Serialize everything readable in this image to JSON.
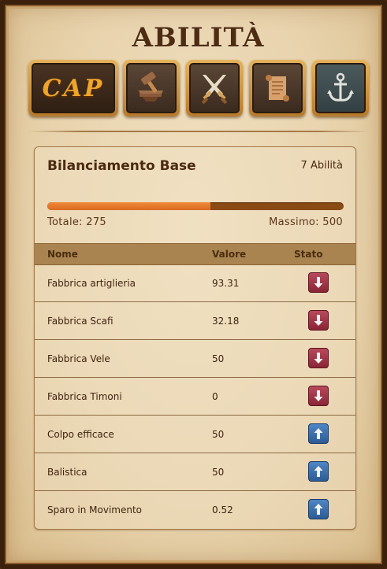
{
  "title": "ABILITÀ",
  "tabs": [
    {
      "label": "CAP",
      "icon": "cap-text-icon",
      "active": true
    },
    {
      "label": "",
      "icon": "hammer-anvil-icon",
      "active": false
    },
    {
      "label": "",
      "icon": "crossed-swords-icon",
      "active": false
    },
    {
      "label": "",
      "icon": "scroll-icon",
      "active": false
    },
    {
      "label": "",
      "icon": "anchor-icon",
      "active": false
    }
  ],
  "panel": {
    "title": "Bilanciamento Base",
    "count": "7 Abilità",
    "progress_fraction": 0.55,
    "total_label": "Totale: 275",
    "max_label": "Massimo: 500",
    "colors": {
      "bar_fill": "#d96a1f",
      "bar_track": "#8a4a14",
      "down": "#9b3346",
      "up": "#3a6eab"
    }
  },
  "table": {
    "headers": {
      "name": "Nome",
      "value": "Valore",
      "status": "Stato"
    },
    "rows": [
      {
        "name": "Fabbrica artiglieria",
        "value": "93.31",
        "status": "down"
      },
      {
        "name": "Fabbrica Scafi",
        "value": "32.18",
        "status": "down"
      },
      {
        "name": "Fabbrica Vele",
        "value": "50",
        "status": "down"
      },
      {
        "name": "Fabbrica Timoni",
        "value": "0",
        "status": "down"
      },
      {
        "name": "Colpo efficace",
        "value": "50",
        "status": "up"
      },
      {
        "name": "Balistica",
        "value": "50",
        "status": "up"
      },
      {
        "name": "Sparo in Movimento",
        "value": "0.52",
        "status": "up"
      }
    ]
  }
}
